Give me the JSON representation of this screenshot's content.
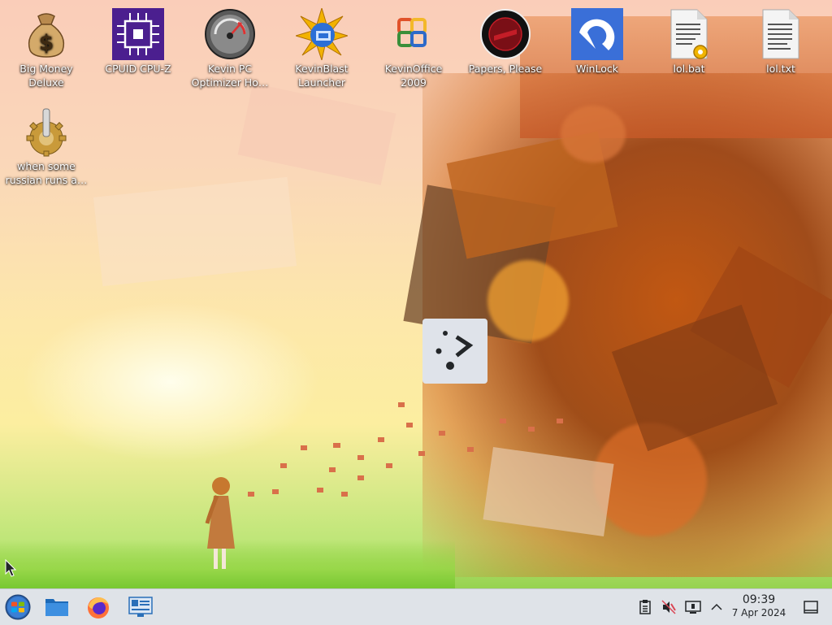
{
  "desktop_icons": [
    {
      "id": "big-money",
      "label": "Big Money Deluxe",
      "icon": "money-bag-icon"
    },
    {
      "id": "cpu-z",
      "label": "CPUID CPU-Z",
      "icon": "cpu-chip-icon"
    },
    {
      "id": "kevin-pc",
      "label": "Kevin PC Optimizer Ho…",
      "icon": "speedometer-icon"
    },
    {
      "id": "kevinblast",
      "label": "KevinBlast Launcher",
      "icon": "starburst-globe-icon"
    },
    {
      "id": "kevinoffice",
      "label": "KevinOffice 2009",
      "icon": "office-logo-icon"
    },
    {
      "id": "papers-please",
      "label": "Papers, Please",
      "icon": "papers-please-seal-icon"
    },
    {
      "id": "winlock",
      "label": "WinLock",
      "icon": "winlock-icon"
    },
    {
      "id": "lol-bat",
      "label": "lol.bat",
      "icon": "batch-file-icon"
    },
    {
      "id": "lol-txt",
      "label": "lol.txt",
      "icon": "text-file-icon"
    },
    {
      "id": "russian",
      "label": "when some russian runs a…",
      "icon": "gear-joystick-icon"
    }
  ],
  "taskbar": {
    "start_icon": "start-menu-orb-icon",
    "pinned": [
      "file-manager-icon",
      "firefox-icon",
      "system-settings-icon"
    ],
    "tray": [
      "clipboard-icon",
      "volume-muted-icon",
      "display-icon",
      "expand-tray-icon"
    ],
    "clock": {
      "time": "09:39",
      "date": "7 Apr 2024"
    },
    "show_desktop_icon": "show-desktop-icon"
  },
  "colors": {
    "taskbar_bg": "#dfe3e8",
    "text_dark": "#232629",
    "launcher_bg": "#dfe3ea"
  }
}
